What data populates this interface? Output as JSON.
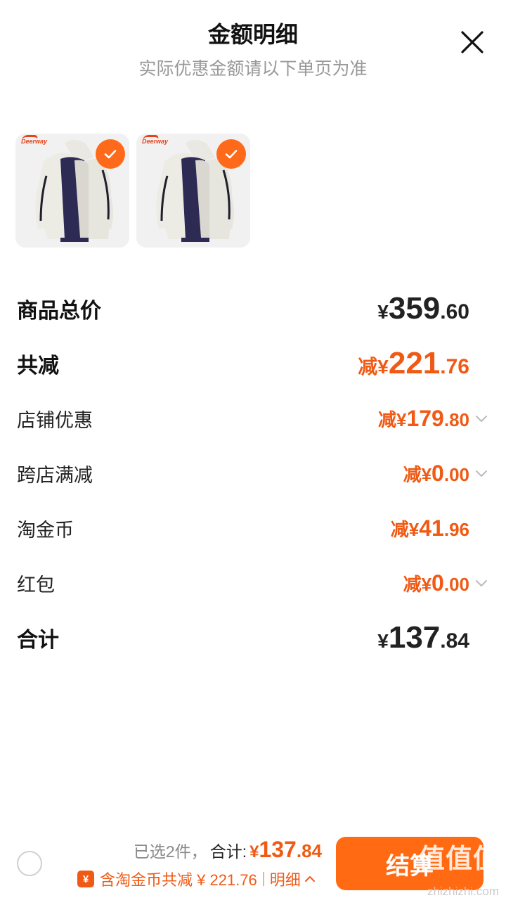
{
  "header": {
    "title": "金额明细",
    "subtitle": "实际优惠金额请以下单页为准"
  },
  "thumbnails": [
    {
      "brand": "Deerway",
      "selected": true
    },
    {
      "brand": "Deerway",
      "selected": true
    }
  ],
  "rows": {
    "total_price": {
      "label": "商品总价",
      "prefix": "¥",
      "int": "359",
      "dec": ".60"
    },
    "total_reduce": {
      "label": "共减",
      "prefix": "减¥",
      "int": "221",
      "dec": ".76"
    },
    "shop_discount": {
      "label": "店铺优惠",
      "prefix": "减¥",
      "int": "179",
      "dec": ".80"
    },
    "cross_store": {
      "label": "跨店满减",
      "prefix": "减¥",
      "int": "0",
      "dec": ".00"
    },
    "taojinbi": {
      "label": "淘金币",
      "prefix": "减¥",
      "int": "41",
      "dec": ".96"
    },
    "red_packet": {
      "label": "红包",
      "prefix": "减¥",
      "int": "0",
      "dec": ".00"
    },
    "sum": {
      "label": "合计",
      "prefix": "¥",
      "int": "137",
      "dec": ".84"
    }
  },
  "bottom": {
    "selected_text": "已选2件，",
    "total_label": "合计:",
    "total_prefix": "¥",
    "total_int": "137",
    "total_dec": ".84",
    "coin_icon": "¥",
    "save_text": "含淘金币共减 ¥ 221.76",
    "detail_label": "明细",
    "checkout_label": "结算"
  },
  "watermark": {
    "text": "值值值",
    "sub": "zhizhizhi.com"
  },
  "colors": {
    "accent": "#ff6a12",
    "price_orange": "#f05a14",
    "text_dark": "#222222",
    "text_muted": "#999999"
  }
}
